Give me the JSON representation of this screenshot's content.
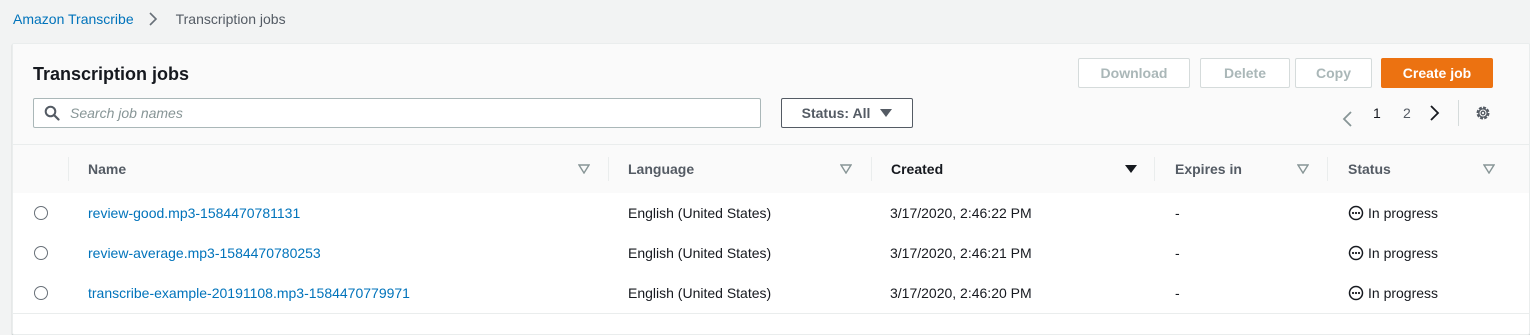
{
  "breadcrumb": {
    "service": "Amazon Transcribe",
    "current": "Transcription jobs"
  },
  "panel": {
    "title": "Transcription jobs",
    "buttons": {
      "download": "Download",
      "delete": "Delete",
      "copy": "Copy",
      "create": "Create job"
    },
    "search": {
      "placeholder": "Search job names",
      "value": ""
    },
    "status_filter": "Status: All",
    "pagination": {
      "pages": [
        "1",
        "2"
      ],
      "current": "1"
    }
  },
  "table": {
    "columns": [
      "Name",
      "Language",
      "Created",
      "Expires in",
      "Status"
    ],
    "sorted_column": "Created",
    "rows": [
      {
        "name": "review-good.mp3-1584470781131",
        "language": "English (United States)",
        "created": "3/17/2020, 2:46:22 PM",
        "expires": "-",
        "status": "In progress"
      },
      {
        "name": "review-average.mp3-1584470780253",
        "language": "English (United States)",
        "created": "3/17/2020, 2:46:21 PM",
        "expires": "-",
        "status": "In progress"
      },
      {
        "name": "transcribe-example-20191108.mp3-1584470779971",
        "language": "English (United States)",
        "created": "3/17/2020, 2:46:20 PM",
        "expires": "-",
        "status": "In progress"
      }
    ]
  },
  "colors": {
    "link": "#0073bb",
    "primary_button": "#ec7211",
    "disabled_text": "#aab7b8",
    "background": "#f2f3f3"
  },
  "icons": [
    "chevron-right-icon",
    "search-icon",
    "caret-down-icon",
    "chevron-left-icon",
    "settings-gear-icon",
    "sort-caret-icon",
    "in-progress-icon"
  ]
}
